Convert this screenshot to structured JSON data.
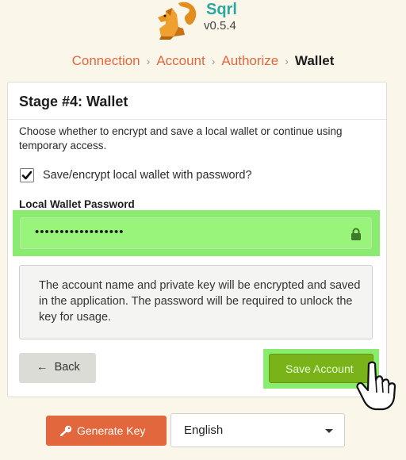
{
  "app": {
    "name": "Sqrl",
    "version": "v0.5.4"
  },
  "breadcrumb": [
    {
      "label": "Connection",
      "active": false
    },
    {
      "label": "Account",
      "active": false
    },
    {
      "label": "Authorize",
      "active": false
    },
    {
      "label": "Wallet",
      "active": true
    }
  ],
  "stage": {
    "title": "Stage #4: Wallet",
    "description": "Choose whether to encrypt and save a local wallet or continue using temporary access.",
    "checkbox_label": "Save/encrypt local wallet with password?",
    "checkbox_checked": true,
    "password_label": "Local Wallet Password",
    "password_value": "••••••••••••••••••",
    "note": "The account name and private key will be encrypted and saved in the application. The password will be required to unlock the key for usage.",
    "back_label": "Back",
    "save_label": "Save Account"
  },
  "footer": {
    "generate_label": "Generate Key",
    "language_value": "English"
  },
  "colors": {
    "brand": "#2aa7a1",
    "accent": "#e2673d",
    "save_button": "#79b319",
    "highlight": "#8aec6f"
  }
}
